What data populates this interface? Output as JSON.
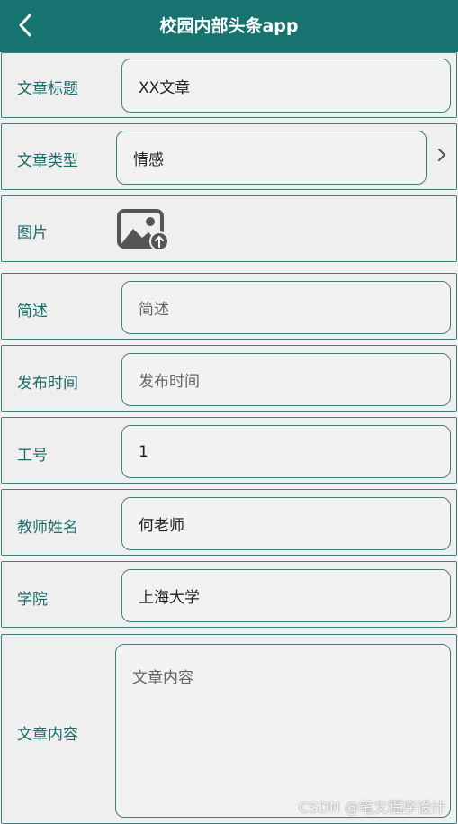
{
  "header": {
    "title": "校园内部头条app"
  },
  "form": {
    "title": {
      "label": "文章标题",
      "value": "XX文章"
    },
    "type": {
      "label": "文章类型",
      "value": "情感"
    },
    "image": {
      "label": "图片"
    },
    "summary": {
      "label": "简述",
      "placeholder": "简述"
    },
    "publish_time": {
      "label": "发布时间",
      "placeholder": "发布时间"
    },
    "employee_id": {
      "label": "工号",
      "value": "1"
    },
    "teacher_name": {
      "label": "教师姓名",
      "value": "何老师"
    },
    "college": {
      "label": "学院",
      "value": "上海大学"
    },
    "content": {
      "label": "文章内容",
      "placeholder": "文章内容"
    }
  },
  "watermark": "CSDN @笔文程序设计",
  "icons": {
    "back": "chevron-left-icon",
    "type_select": "chevron-right-icon",
    "image_upload": "image-upload-icon"
  },
  "colors": {
    "primary": "#16736f",
    "border": "#3f7f7b",
    "label": "#1d6d68"
  }
}
